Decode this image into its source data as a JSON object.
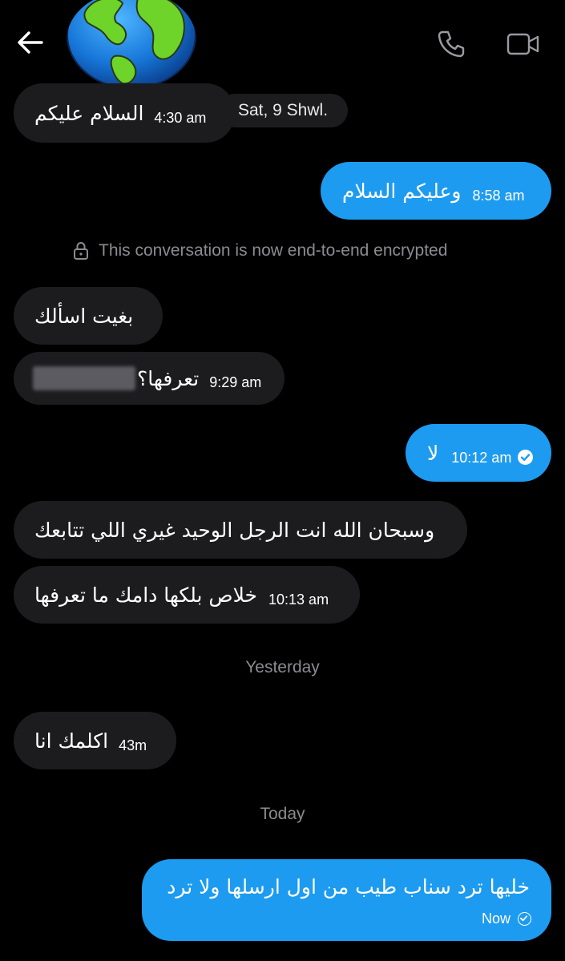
{
  "header": {
    "back_icon": "arrow-left-icon",
    "avatar_icon": "globe-avatar",
    "call_icon": "phone-icon",
    "video_icon": "video-camera-icon"
  },
  "conversation": {
    "date_pill": "Sat, 9 Shwl.",
    "encryption_notice": "This conversation is now end-to-end encrypted",
    "separator_yesterday": "Yesterday",
    "separator_today": "Today",
    "messages": [
      {
        "dir": "in",
        "text": "السلام عليكم",
        "time": "4:30 am"
      },
      {
        "dir": "out",
        "text": "وعليكم السلام",
        "time": "8:58 am"
      },
      {
        "dir": "in",
        "text": "بغيت اسألك",
        "time": ""
      },
      {
        "dir": "in",
        "text": "تعرفها؟",
        "time": "9:29 am"
      },
      {
        "dir": "out",
        "text": "لا",
        "time": "10:12 am",
        "status": "seen-check-icon"
      },
      {
        "dir": "in",
        "text": "وسبحان الله انت الرجل الوحيد غيري اللي تتابعك",
        "time": ""
      },
      {
        "dir": "in",
        "text": "خلاص بلكها دامك ما تعرفها",
        "time": "10:13 am"
      },
      {
        "dir": "in",
        "text": "اكلمك انا",
        "time": "43m"
      },
      {
        "dir": "out",
        "text": "خليها ترد سناب طيب من اول ارسلها ولا ترد",
        "time": "Now",
        "status": "sent-check-icon"
      }
    ]
  },
  "colors": {
    "background": "#000000",
    "incoming_bubble": "#1c1c1e",
    "outgoing_bubble": "#1d9bf0",
    "muted_text": "#8b8b90"
  }
}
